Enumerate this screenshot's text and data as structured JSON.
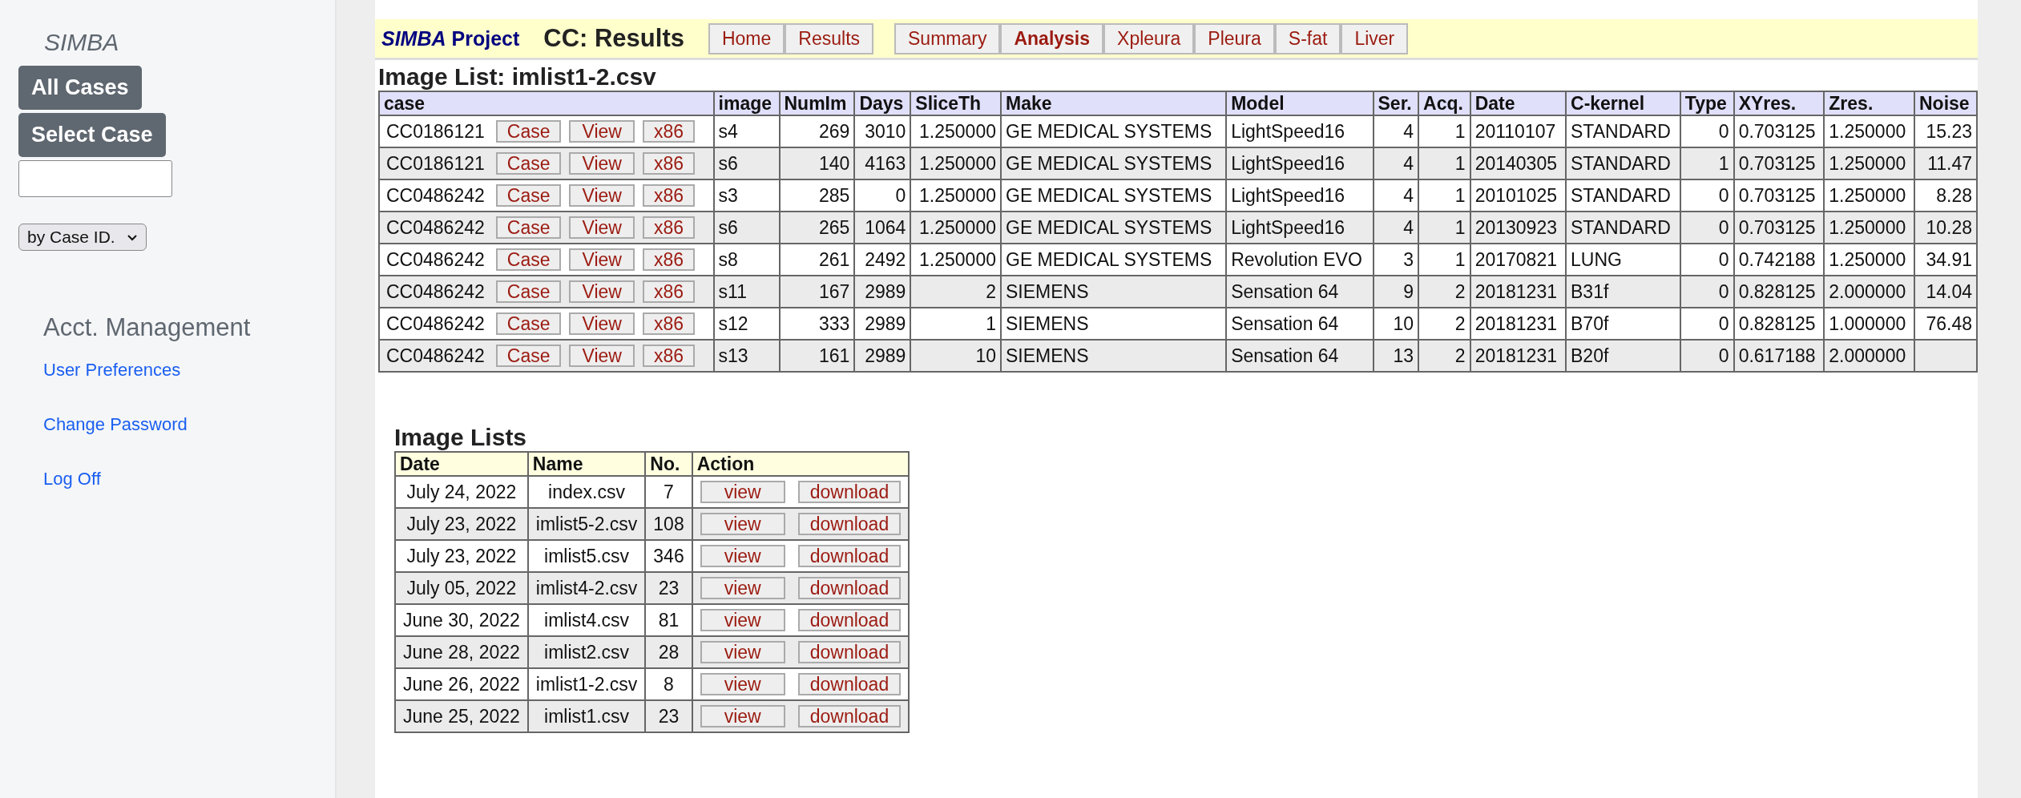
{
  "sidebar": {
    "brand": "SIMBA",
    "buttons": [
      "All Cases",
      "Select Case"
    ],
    "sort_select": {
      "value": "by Case ID."
    },
    "section_title": "Acct. Management",
    "links": [
      "User Preferences",
      "Change Password",
      "Log Off"
    ]
  },
  "header": {
    "project": "*SIMBA* Project",
    "title": "CC: Results",
    "nav_buttons": [
      {
        "label": "Home",
        "selected": false
      },
      {
        "label": "Results",
        "selected": false
      }
    ],
    "tabs": [
      {
        "label": "Summary",
        "selected": false
      },
      {
        "label": "Analysis",
        "selected": true
      },
      {
        "label": "Xpleura",
        "selected": false
      },
      {
        "label": "Pleura",
        "selected": false
      },
      {
        "label": "S-fat",
        "selected": false
      },
      {
        "label": "Liver",
        "selected": false
      }
    ]
  },
  "image_list": {
    "title": "Image List: imlist1-2.csv",
    "columns": [
      "case",
      "image",
      "NumIm",
      "Days",
      "SliceTh",
      "Make",
      "Model",
      "Ser.",
      "Acq.",
      "Date",
      "C-kernel",
      "Type",
      "XYres.",
      "Zres.",
      "Noise"
    ],
    "rows": [
      {
        "cells": [
          "CC0186121",
          "s4",
          "269",
          "3010",
          "1.250000",
          "GE MEDICAL SYSTEMS",
          "LightSpeed16",
          "4",
          "1",
          "20110107",
          "STANDARD",
          "0",
          "0.703125",
          "1.250000",
          "15.23"
        ],
        "buttons": [
          "Case",
          "View",
          "x86"
        ]
      },
      {
        "cells": [
          "CC0186121",
          "s6",
          "140",
          "4163",
          "1.250000",
          "GE MEDICAL SYSTEMS",
          "LightSpeed16",
          "4",
          "1",
          "20140305",
          "STANDARD",
          "1",
          "0.703125",
          "1.250000",
          "11.47"
        ],
        "buttons": [
          "Case",
          "View",
          "x86"
        ]
      },
      {
        "cells": [
          "CC0486242",
          "s3",
          "285",
          "0",
          "1.250000",
          "GE MEDICAL SYSTEMS",
          "LightSpeed16",
          "4",
          "1",
          "20101025",
          "STANDARD",
          "0",
          "0.703125",
          "1.250000",
          "8.28"
        ],
        "buttons": [
          "Case",
          "View",
          "x86"
        ]
      },
      {
        "cells": [
          "CC0486242",
          "s6",
          "265",
          "1064",
          "1.250000",
          "GE MEDICAL SYSTEMS",
          "LightSpeed16",
          "4",
          "1",
          "20130923",
          "STANDARD",
          "0",
          "0.703125",
          "1.250000",
          "10.28"
        ],
        "buttons": [
          "Case",
          "View",
          "x86"
        ]
      },
      {
        "cells": [
          "CC0486242",
          "s8",
          "261",
          "2492",
          "1.250000",
          "GE MEDICAL SYSTEMS",
          "Revolution EVO",
          "3",
          "1",
          "20170821",
          "LUNG",
          "0",
          "0.742188",
          "1.250000",
          "34.91"
        ],
        "buttons": [
          "Case",
          "View",
          "x86"
        ]
      },
      {
        "cells": [
          "CC0486242",
          "s11",
          "167",
          "2989",
          "2",
          "SIEMENS",
          "Sensation 64",
          "9",
          "2",
          "20181231",
          "B31f",
          "0",
          "0.828125",
          "2.000000",
          "14.04"
        ],
        "buttons": [
          "Case",
          "View",
          "x86"
        ]
      },
      {
        "cells": [
          "CC0486242",
          "s12",
          "333",
          "2989",
          "1",
          "SIEMENS",
          "Sensation 64",
          "10",
          "2",
          "20181231",
          "B70f",
          "0",
          "0.828125",
          "1.000000",
          "76.48"
        ],
        "buttons": [
          "Case",
          "View",
          "x86"
        ]
      },
      {
        "cells": [
          "CC0486242",
          "s13",
          "161",
          "2989",
          "10",
          "SIEMENS",
          "Sensation 64",
          "13",
          "2",
          "20181231",
          "B20f",
          "0",
          "0.617188",
          "2.000000"
        ],
        "buttons": [
          "Case",
          "View",
          "x86"
        ]
      }
    ]
  },
  "image_lists": {
    "title": "Image Lists",
    "columns": [
      "Date",
      "Name",
      "No.",
      "Action"
    ],
    "rows": [
      {
        "date": "July 24, 2022",
        "name": "index.csv",
        "count": "7",
        "actions": [
          "view",
          "download"
        ]
      },
      {
        "date": "July 23, 2022",
        "name": "imlist5-2.csv",
        "count": "108",
        "actions": [
          "view",
          "download"
        ]
      },
      {
        "date": "July 23, 2022",
        "name": "imlist5.csv",
        "count": "346",
        "actions": [
          "view",
          "download"
        ]
      },
      {
        "date": "July 05, 2022",
        "name": "imlist4-2.csv",
        "count": "23",
        "actions": [
          "view",
          "download"
        ]
      },
      {
        "date": "June 30, 2022",
        "name": "imlist4.csv",
        "count": "81",
        "actions": [
          "view",
          "download"
        ]
      },
      {
        "date": "June 28, 2022",
        "name": "imlist2.csv",
        "count": "28",
        "actions": [
          "view",
          "download"
        ]
      },
      {
        "date": "June 26, 2022",
        "name": "imlist1-2.csv",
        "count": "8",
        "actions": [
          "view",
          "download"
        ]
      },
      {
        "date": "June 25, 2022",
        "name": "imlist1.csv",
        "count": "23",
        "actions": [
          "view",
          "download"
        ]
      }
    ]
  }
}
